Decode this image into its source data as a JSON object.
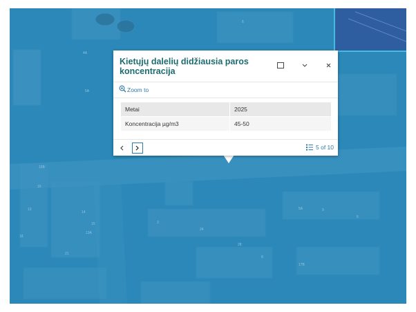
{
  "popup": {
    "title": "Kietųjų dalelių didžiausia paros koncentracija",
    "zoom_label": "Zoom to",
    "attributes": [
      {
        "key": "Metai",
        "value": "2025"
      },
      {
        "key": "Koncentracija µg/m3",
        "value": "45-50"
      }
    ],
    "pager_label": "5 of 10",
    "icons": {
      "dock": "dock-icon",
      "collapse": "chevron-down-icon",
      "close": "close-icon",
      "zoom": "zoom-in-icon",
      "prev": "chevron-left-icon",
      "next": "chevron-right-icon",
      "list": "feature-list-icon"
    }
  },
  "map": {
    "house_numbers": [
      "4A",
      "6",
      "5A",
      "15B",
      "16",
      "13",
      "18",
      "14",
      "13A",
      "15",
      "3",
      "5A",
      "9",
      "24",
      "5",
      "8",
      "28",
      "17B",
      "21"
    ],
    "colors": {
      "overlay": "#2b88b8",
      "highlight_outline": "#4fd3f0",
      "accent": "#2e78a8",
      "title": "#1c6b6f"
    }
  }
}
